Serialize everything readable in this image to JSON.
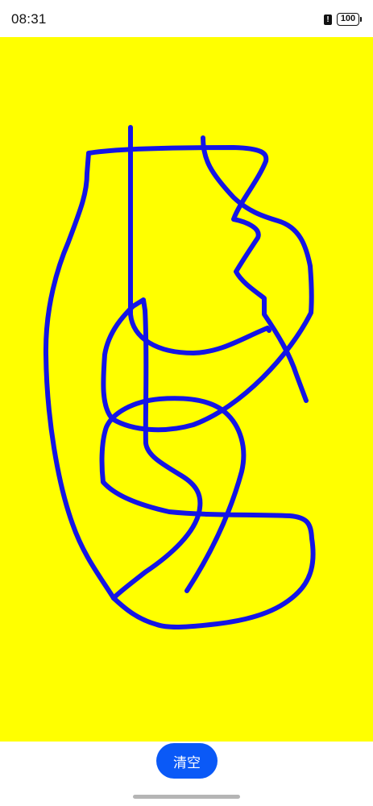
{
  "status_bar": {
    "time": "08:31",
    "alert_icon": "exclamation-icon",
    "battery_level": "100"
  },
  "canvas": {
    "background_color": "#ffff00",
    "stroke_color": "#1414e6"
  },
  "toolbar": {
    "clear_label": "清空",
    "clear_color": "#0a59f7"
  }
}
